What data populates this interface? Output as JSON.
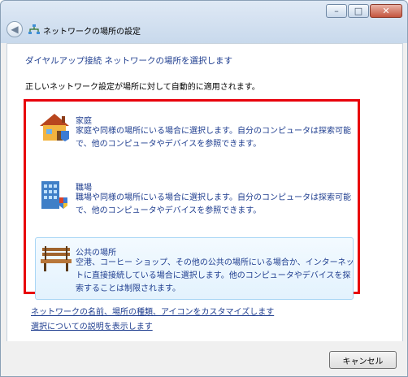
{
  "window": {
    "title": "ネットワークの場所の設定",
    "buttons": {
      "minimize": "–",
      "maximize": "□",
      "close": "✕"
    }
  },
  "page": {
    "heading": "ダイヤルアップ接続  ネットワークの場所を選択します",
    "description": "正しいネットワーク設定が場所に対して自動的に適用されます。"
  },
  "options": [
    {
      "title": "家庭",
      "text": "家庭や同様の場所にいる場合に選択します。自分のコンピュータは探索可能で、他のコンピュータやデバイスを参照できます。",
      "icon": "house-icon"
    },
    {
      "title": "職場",
      "text": "職場や同様の場所にいる場合に選択します。自分のコンピュータは探索可能で、他のコンピュータやデバイスを参照できます。",
      "icon": "office-building-icon"
    },
    {
      "title": "公共の場所",
      "text": "空港、コーヒー ショップ、その他の公共の場所にいる場合か、インターネットに直接接続している場合に選択します。他のコンピュータやデバイスを探索することは制限されます。",
      "icon": "park-bench-icon"
    }
  ],
  "links": {
    "customize": "ネットワークの名前、場所の種類、アイコンをカスタマイズします",
    "explain": "選択についての説明を表示します"
  },
  "footer": {
    "cancel_label": "キャンセル"
  },
  "colors": {
    "highlight_border": "#e8000b",
    "link": "#1e3d8f"
  }
}
